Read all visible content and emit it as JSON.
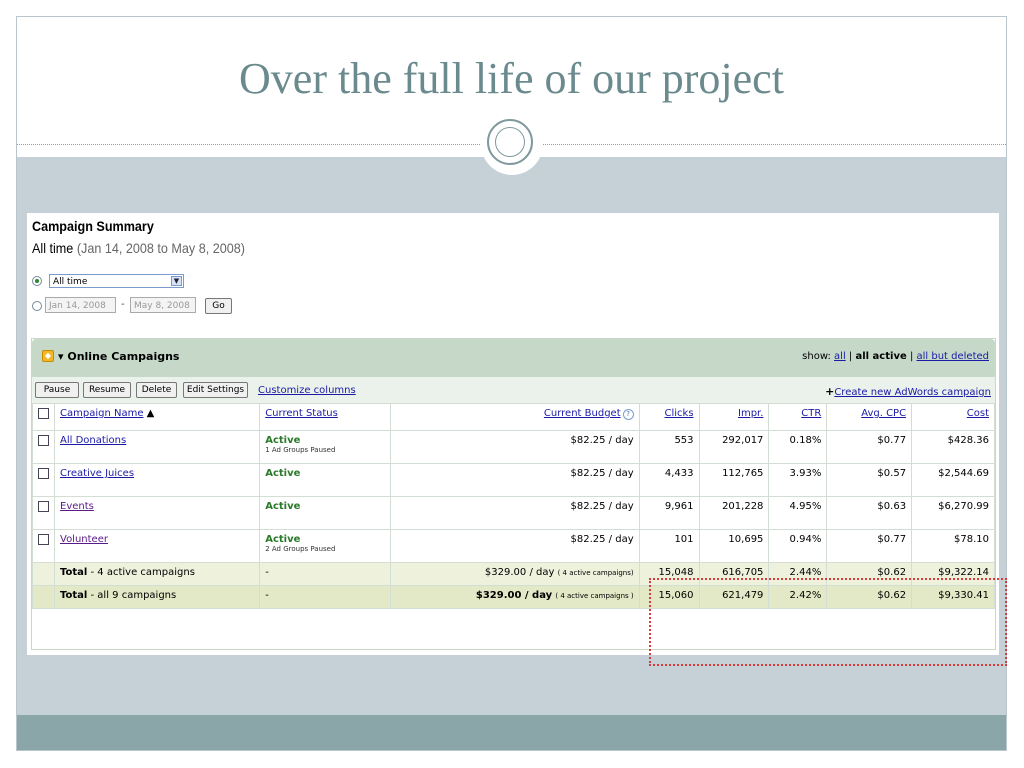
{
  "slide": {
    "title": "Over the full life of our project"
  },
  "summary": {
    "heading": "Campaign Summary",
    "range_prefix": "All time",
    "range_dates": "(Jan 14, 2008 to May 8, 2008)",
    "select_value": "All time",
    "start_date": "Jan 14, 2008",
    "end_date": "May 8, 2008",
    "date_separator": "-",
    "go_label": "Go"
  },
  "panel": {
    "title": "Online Campaigns",
    "show_label": "show:",
    "show_all": "all",
    "show_active": "all active",
    "show_but_deleted": "all but deleted",
    "sep": "|"
  },
  "toolbar": {
    "pause": "Pause",
    "resume": "Resume",
    "delete": "Delete",
    "edit_settings": "Edit Settings",
    "customize": "Customize columns",
    "create_plus": "+",
    "create": "Create new AdWords campaign"
  },
  "table": {
    "headers": {
      "name": "Campaign Name",
      "sort_arrow": "▲",
      "status": "Current Status",
      "budget": "Current Budget",
      "clicks": "Clicks",
      "impr": "Impr.",
      "ctr": "CTR",
      "cpc": "Avg. CPC",
      "cost": "Cost"
    },
    "rows": [
      {
        "name": "All Donations",
        "status": "Active",
        "status_sub": "1 Ad Groups Paused",
        "budget": "$82.25 / day",
        "clicks": "553",
        "impr": "292,017",
        "ctr": "0.18%",
        "cpc": "$0.77",
        "cost": "$428.36"
      },
      {
        "name": "Creative Juices",
        "status": "Active",
        "status_sub": "",
        "budget": "$82.25 / day",
        "clicks": "4,433",
        "impr": "112,765",
        "ctr": "3.93%",
        "cpc": "$0.57",
        "cost": "$2,544.69"
      },
      {
        "name": "Events",
        "status": "Active",
        "status_sub": "",
        "budget": "$82.25 / day",
        "clicks": "9,961",
        "impr": "201,228",
        "ctr": "4.95%",
        "cpc": "$0.63",
        "cost": "$6,270.99"
      },
      {
        "name": "Volunteer",
        "status": "Active",
        "status_sub": "2 Ad Groups Paused",
        "budget": "$82.25 / day",
        "clicks": "101",
        "impr": "10,695",
        "ctr": "0.94%",
        "cpc": "$0.77",
        "cost": "$78.10"
      }
    ],
    "total_active": {
      "label": "Total",
      "label_rest": " - 4 active campaigns",
      "status": "-",
      "budget": "$329.00 / day",
      "budget_note": "( 4 active campaigns)",
      "clicks": "15,048",
      "impr": "616,705",
      "ctr": "2.44%",
      "cpc": "$0.62",
      "cost": "$9,322.14"
    },
    "total_all": {
      "label": "Total",
      "label_rest": " - all 9 campaigns",
      "status": "-",
      "budget": "$329.00 / day",
      "budget_note": "( 4 active campaigns )",
      "clicks": "15,060",
      "impr": "621,479",
      "ctr": "2.42%",
      "cpc": "$0.62",
      "cost": "$9,330.41"
    }
  },
  "colors": {
    "title": "#6b8a8d",
    "slide_bg": "#c5d1d6",
    "footer_band": "#8ba6a8",
    "status_active": "#2a7a2a",
    "highlight": "#d63b3b"
  }
}
